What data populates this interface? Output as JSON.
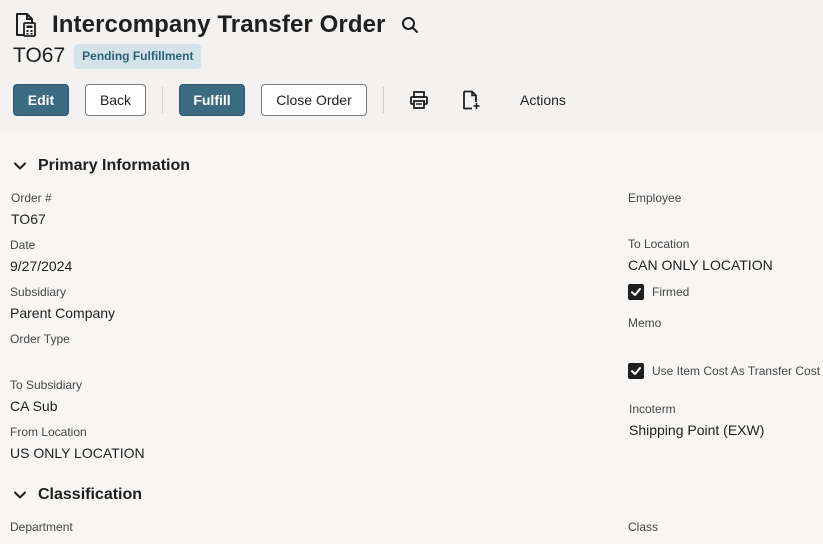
{
  "header": {
    "title": "Intercompany Transfer Order",
    "record_id": "TO67",
    "status": "Pending Fulfillment",
    "page_icon": "document-calculator-icon",
    "search_icon": "search-icon"
  },
  "toolbar": {
    "edit_label": "Edit",
    "back_label": "Back",
    "fulfill_label": "Fulfill",
    "close_order_label": "Close Order",
    "print_icon": "print-icon",
    "new_document_icon": "new-document-icon",
    "actions_label": "Actions"
  },
  "primary": {
    "section_title": "Primary Information",
    "order_num": {
      "label": "Order #",
      "value": "TO67"
    },
    "date": {
      "label": "Date",
      "value": "9/27/2024"
    },
    "subsidiary": {
      "label": "Subsidiary",
      "value": "Parent Company"
    },
    "order_type": {
      "label": "Order Type",
      "value": ""
    },
    "to_subsidiary": {
      "label": "To Subsidiary",
      "value": "CA Sub"
    },
    "from_location": {
      "label": "From Location",
      "value": "US ONLY LOCATION"
    },
    "employee": {
      "label": "Employee",
      "value": ""
    },
    "to_location": {
      "label": "To Location",
      "value": "CAN ONLY LOCATION"
    },
    "firmed": {
      "label": "Firmed",
      "checked": true
    },
    "memo": {
      "label": "Memo",
      "value": ""
    },
    "use_item_cost": {
      "label": "Use Item Cost As Transfer Cost",
      "checked": true
    },
    "incoterm": {
      "label": "Incoterm",
      "value": "Shipping Point (EXW)"
    }
  },
  "classification": {
    "section_title": "Classification",
    "department": {
      "label": "Department",
      "value": ""
    },
    "class": {
      "label": "Class",
      "value": ""
    }
  },
  "colors": {
    "primary_button": "#3b6b80",
    "status_badge_bg": "#d4e3ea",
    "status_badge_text": "#2a6378",
    "header_bg": "#f3f2f1",
    "page_bg": "#f7f6f4"
  }
}
